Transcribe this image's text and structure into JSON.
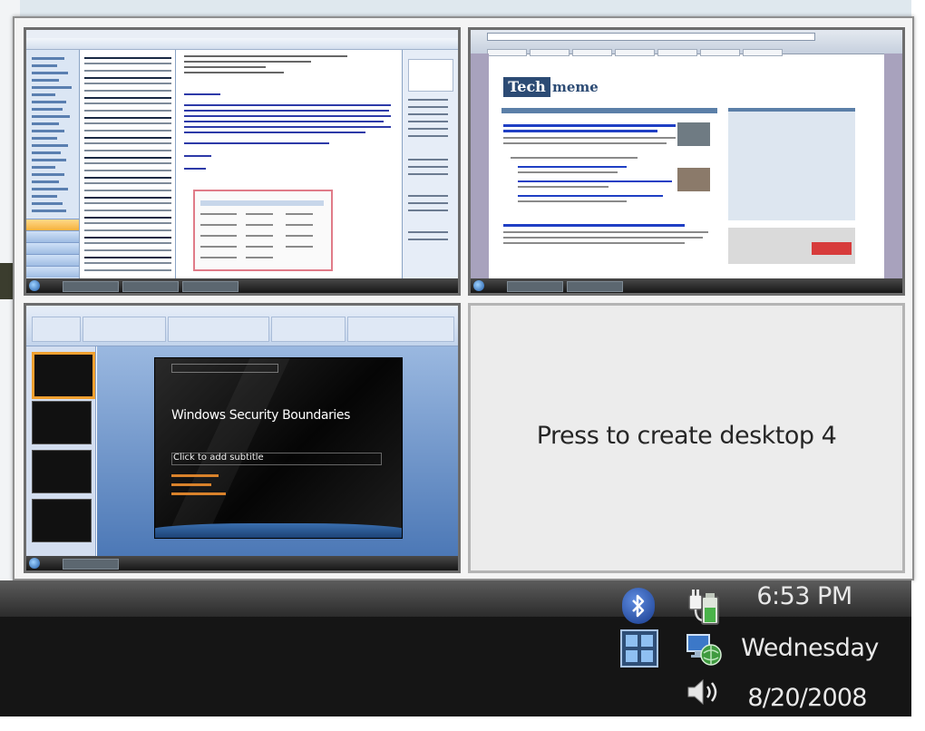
{
  "desktop_switcher": {
    "create_desktop_label": "Press to create desktop 4"
  },
  "desktop_3": {
    "slide_title": "Windows Security Boundaries",
    "slide_subtitle": "Click to add subtitle"
  },
  "desktop_2": {
    "site_logo_dark": "Tech",
    "site_logo_light": "meme"
  },
  "tray": {
    "time": "6:53 PM",
    "day": "Wednesday",
    "date": "8/20/2008",
    "icons": [
      "bluetooth-icon",
      "power-icon",
      "virtual-desktops-icon",
      "network-icon",
      "volume-icon"
    ]
  },
  "colors": {
    "taskbar": "#151515",
    "tray_text": "#e8e8e8",
    "switcher_bg": "#f4f4f4"
  }
}
